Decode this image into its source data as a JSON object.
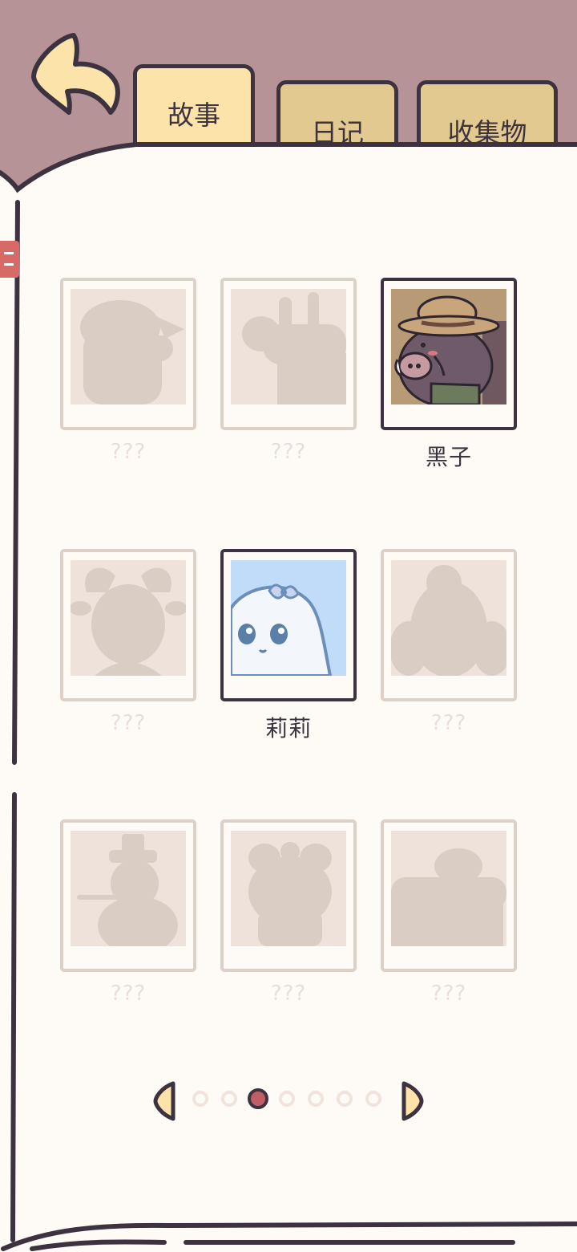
{
  "tabs": [
    {
      "label": "故事",
      "active": true
    },
    {
      "label": "日记",
      "active": false
    },
    {
      "label": "收集物",
      "active": false
    }
  ],
  "characters": [
    {
      "label": "???",
      "unlocked": false,
      "icon": "silhouette-girl-icon"
    },
    {
      "label": "???",
      "unlocked": false,
      "icon": "silhouette-giraffe-icon"
    },
    {
      "label": "黑子",
      "unlocked": true,
      "icon": "boar-farmer-portrait"
    },
    {
      "label": "???",
      "unlocked": false,
      "icon": "silhouette-ram-icon"
    },
    {
      "label": "莉莉",
      "unlocked": true,
      "icon": "ghost-bow-portrait"
    },
    {
      "label": "???",
      "unlocked": false,
      "icon": "silhouette-dog-icon"
    },
    {
      "label": "???",
      "unlocked": false,
      "icon": "silhouette-wizard-icon"
    },
    {
      "label": "???",
      "unlocked": false,
      "icon": "silhouette-bow-girl-icon"
    },
    {
      "label": "???",
      "unlocked": false,
      "icon": "silhouette-house-icon"
    }
  ],
  "pagination": {
    "total_pages": 7,
    "current_page": 3
  },
  "colors": {
    "background": "#b69396",
    "page": "#fefbf6",
    "ink": "#3d3340",
    "tab_active": "#fbe3aa",
    "tab_inactive": "#e2c98f",
    "locked_frame": "#ddd0c7",
    "active_dot": "#c15d65"
  }
}
